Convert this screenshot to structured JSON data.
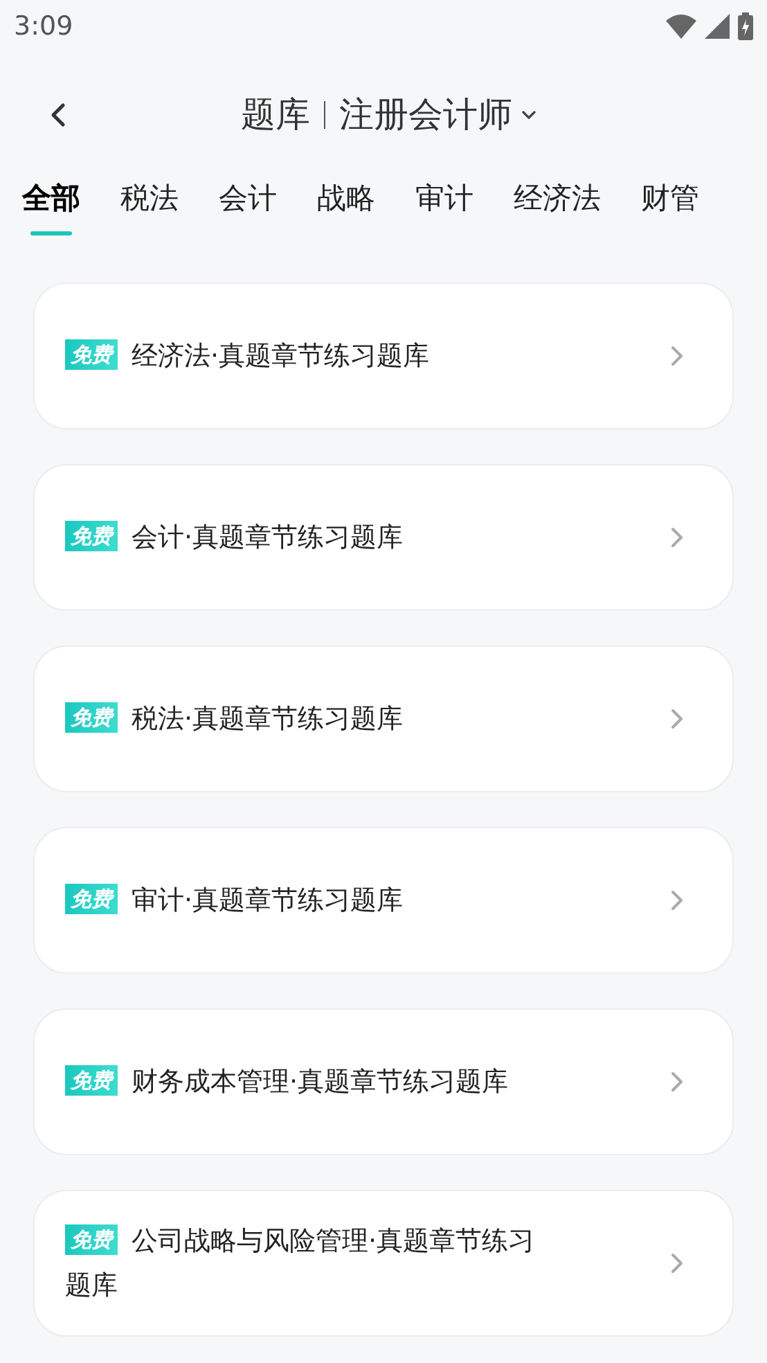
{
  "status_bar": {
    "time": "3:09"
  },
  "header": {
    "title": "题库",
    "subtitle": "注册会计师"
  },
  "tabs": [
    {
      "label": "全部",
      "selected": true
    },
    {
      "label": "税法",
      "selected": false
    },
    {
      "label": "会计",
      "selected": false
    },
    {
      "label": "战略",
      "selected": false
    },
    {
      "label": "审计",
      "selected": false
    },
    {
      "label": "经济法",
      "selected": false
    },
    {
      "label": "财管",
      "selected": false
    }
  ],
  "items": [
    {
      "badge": "免费",
      "title": "经济法·真题章节练习题库"
    },
    {
      "badge": "免费",
      "title": "会计·真题章节练习题库"
    },
    {
      "badge": "免费",
      "title": "税法·真题章节练习题库"
    },
    {
      "badge": "免费",
      "title": "审计·真题章节练习题库"
    },
    {
      "badge": "免费",
      "title": "财务成本管理·真题章节练习题库"
    },
    {
      "badge": "免费",
      "title": "公司战略与风险管理·真题章节练习题库"
    }
  ]
}
